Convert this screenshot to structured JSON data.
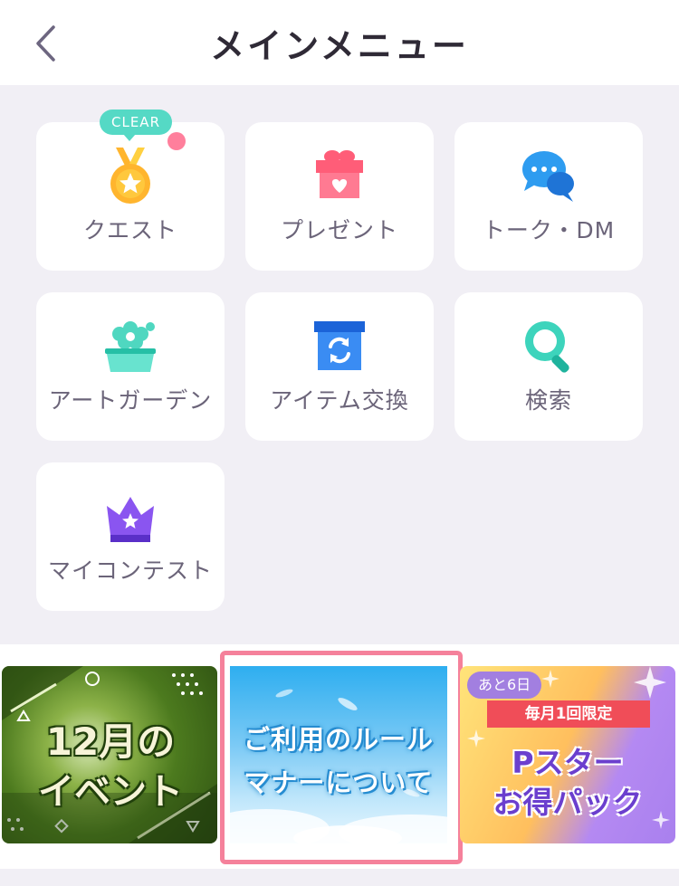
{
  "header": {
    "title": "メインメニュー",
    "back_icon": "chevron-left-icon"
  },
  "menu": {
    "items": [
      {
        "label": "クエスト",
        "icon": "medal-icon",
        "badge": "CLEAR",
        "has_notification_dot": true
      },
      {
        "label": "プレゼント",
        "icon": "gift-icon"
      },
      {
        "label": "トーク・DM",
        "icon": "chat-bubbles-icon"
      },
      {
        "label": "アートガーデン",
        "icon": "flower-pot-icon"
      },
      {
        "label": "アイテム交換",
        "icon": "exchange-box-icon"
      },
      {
        "label": "検索",
        "icon": "search-icon"
      },
      {
        "label": "マイコンテスト",
        "icon": "crown-icon"
      }
    ]
  },
  "banners": [
    {
      "line1": "12月の",
      "line2": "イベント"
    },
    {
      "line1": "ご利用のルール",
      "line2": "マナーについて",
      "selected": true
    },
    {
      "remaining": "あと6日",
      "ribbon": "毎月1回限定",
      "line1": "Pスター",
      "line2": "お得パック"
    }
  ],
  "colors": {
    "accent_teal": "#55d9c5",
    "notification_dot": "#ff7f9c",
    "selection_border": "#f5819b",
    "page_bg": "#f1eff5"
  }
}
